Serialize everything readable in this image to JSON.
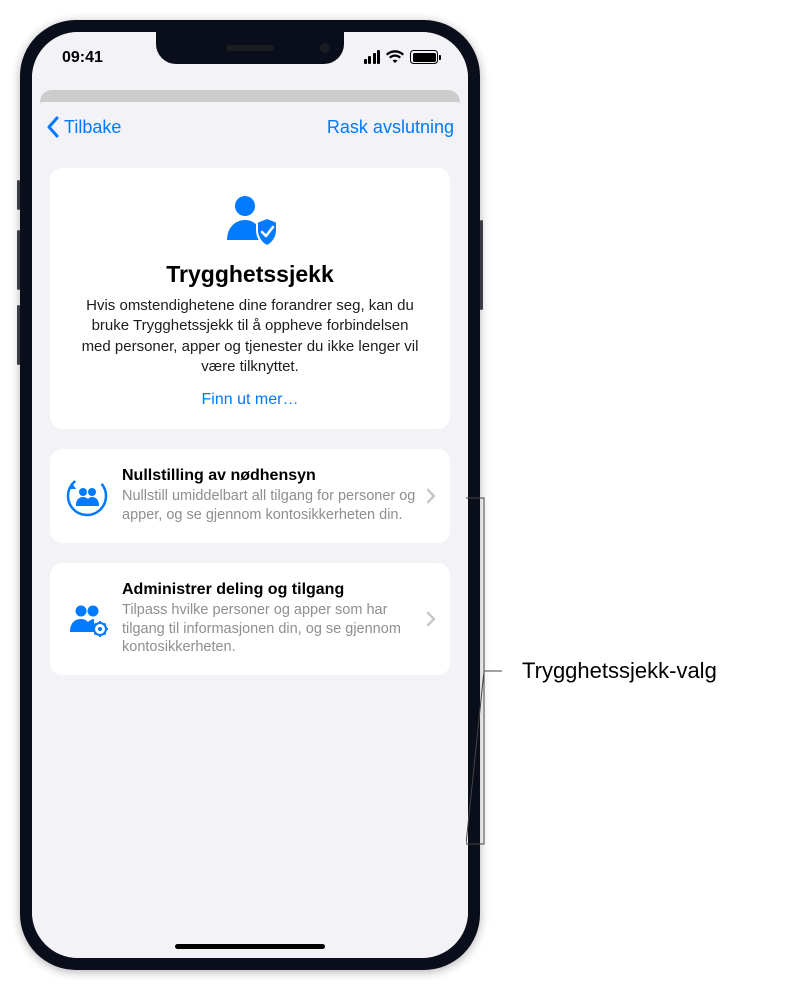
{
  "status_bar": {
    "time": "09:41"
  },
  "nav": {
    "back_label": "Tilbake",
    "right_label": "Rask avslutning"
  },
  "hero": {
    "title": "Trygghetssjekk",
    "description": "Hvis omstendighetene dine forandrer seg, kan du bruke Trygghetssjekk til å oppheve forbindelsen med personer, apper og tjenester du ikke lenger vil være tilknyttet.",
    "learn_more": "Finn ut mer…"
  },
  "options": [
    {
      "title": "Nullstilling av nødhensyn",
      "description": "Nullstill umiddelbart all tilgang for personer og apper, og se gjennom kontosikkerheten din."
    },
    {
      "title": "Administrer deling og tilgang",
      "description": "Tilpass hvilke personer og apper som har tilgang til informasjonen din, og se gjennom kontosikkerheten."
    }
  ],
  "callout": {
    "label": "Trygghetssjekk-valg"
  },
  "colors": {
    "accent": "#007aff",
    "background": "#f2f2f7",
    "card": "#ffffff",
    "secondary_text": "#8e8e93"
  }
}
